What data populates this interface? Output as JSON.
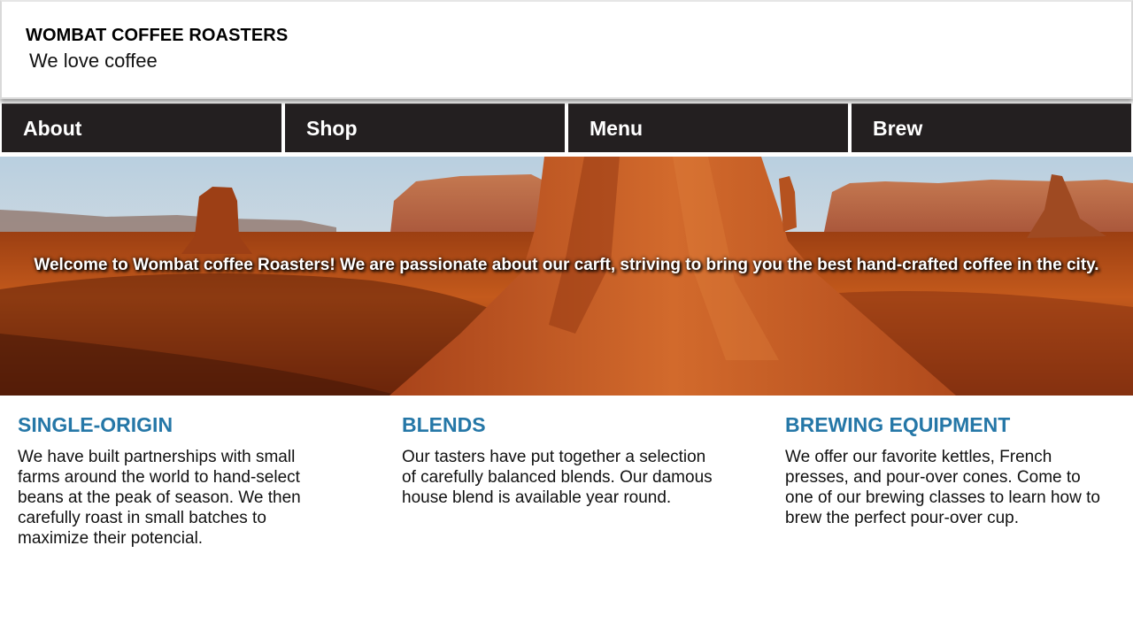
{
  "header": {
    "brand": "WOMBAT COFFEE ROASTERS",
    "tagline": "We love coffee"
  },
  "nav": {
    "items": [
      {
        "label": "About"
      },
      {
        "label": "Shop"
      },
      {
        "label": "Menu"
      },
      {
        "label": "Brew"
      }
    ]
  },
  "hero": {
    "message": "Welcome to Wombat coffee Roasters! We are passionate about our carft, striving to bring you the best hand-crafted coffee in the city."
  },
  "features": [
    {
      "title": "SINGLE-ORIGIN",
      "text": "We have built partnerships with small farms around the world to hand-select beans at the peak of season. We then carefully roast in small batches to maximize their potencial."
    },
    {
      "title": "BLENDS",
      "text": "Our tasters have put together a selection of carefully balanced blends. Our damous house blend is available year round."
    },
    {
      "title": "BREWING EQUIPMENT",
      "text": "We offer our favorite kettles, French presses, and pour-over cones. Come to one of our brewing classes to learn how to brew the perfect pour-over cup."
    }
  ],
  "colors": {
    "nav_bg": "#231f20",
    "heading_blue": "#2577a7"
  }
}
